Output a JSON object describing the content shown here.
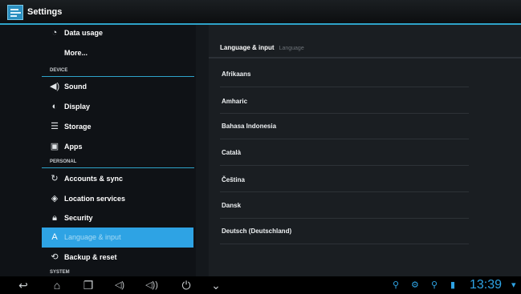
{
  "window": {
    "title": "Settings"
  },
  "sidebar": {
    "items": [
      {
        "label": "Data usage",
        "icon": "data-usage-icon"
      },
      {
        "label": "More...",
        "icon": ""
      },
      {
        "label": "Sound",
        "icon": "speaker-icon"
      },
      {
        "label": "Display",
        "icon": "display-icon"
      },
      {
        "label": "Storage",
        "icon": "storage-icon"
      },
      {
        "label": "Apps",
        "icon": "apps-icon"
      },
      {
        "label": "Accounts & sync",
        "icon": "sync-icon"
      },
      {
        "label": "Location services",
        "icon": "location-icon"
      },
      {
        "label": "Security",
        "icon": "lock-icon"
      },
      {
        "label": "Language & input",
        "icon": "keyboard-icon"
      },
      {
        "label": "Backup & reset",
        "icon": "backup-icon"
      }
    ],
    "sections": [
      "DEVICE",
      "PERSONAL",
      "SYSTEM"
    ],
    "selected": "Language & input"
  },
  "content": {
    "header": "Language & input",
    "header_sub": "Language",
    "languages": [
      "Afrikaans",
      "Amharic",
      "Bahasa Indonesia",
      "Català",
      "Čeština",
      "Dansk",
      "Deutsch (Deutschland)"
    ]
  },
  "status_bar": {
    "time": "13:39"
  },
  "colors": {
    "accent": "#2ea3e4",
    "background": "#0f1216"
  }
}
